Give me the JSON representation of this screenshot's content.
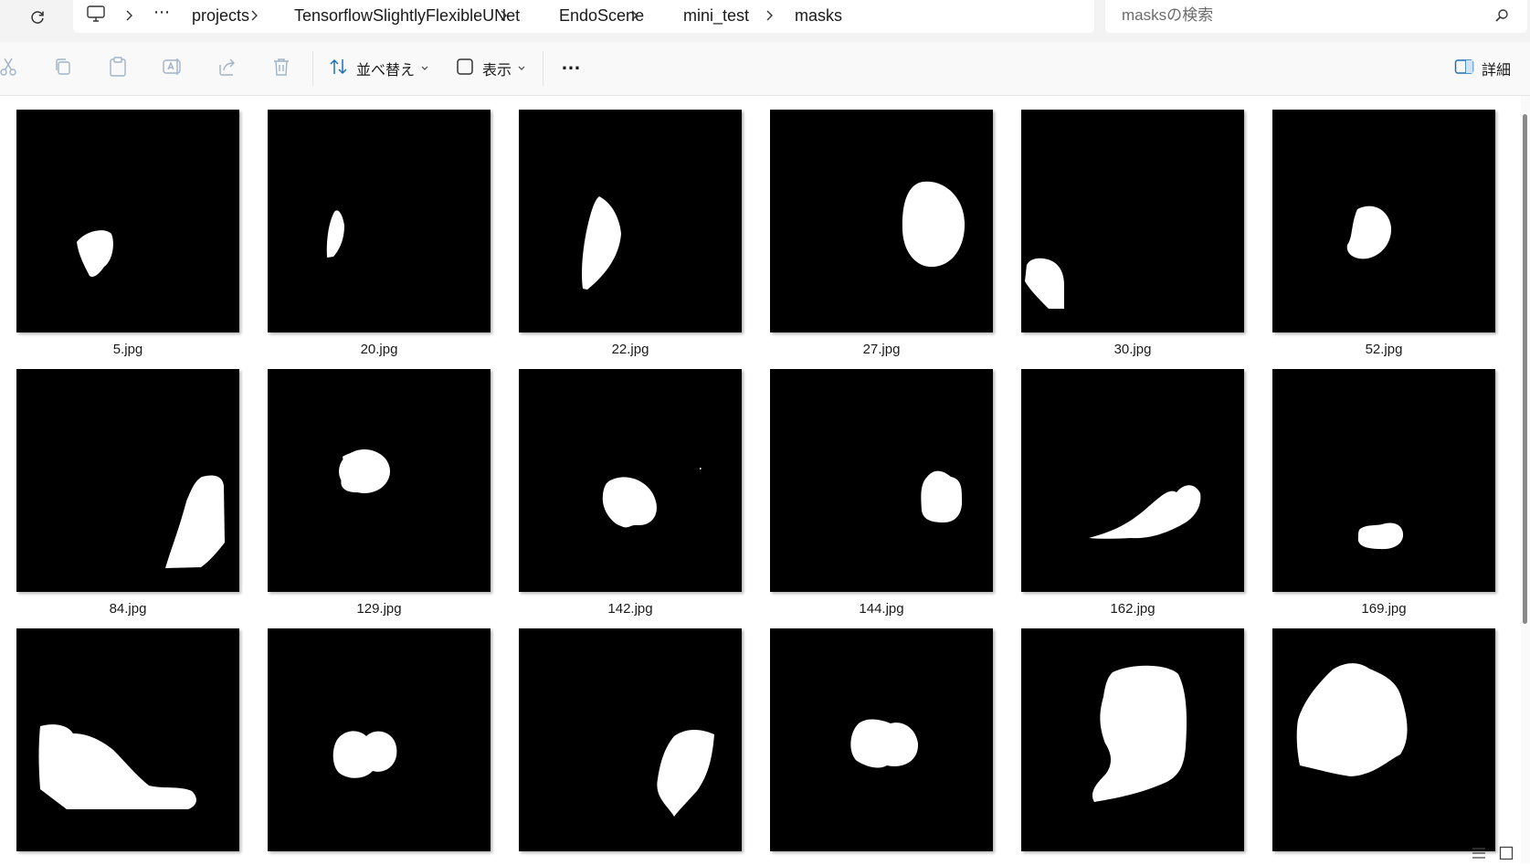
{
  "address": {
    "overflow": "⋯",
    "crumbs": [
      "projects",
      "TensorflowSlightlyFlexibleUNet",
      "EndoScene",
      "mini_test",
      "masks"
    ]
  },
  "search": {
    "placeholder": "masksの検索"
  },
  "toolbar": {
    "sort_label": "並べ替え",
    "view_label": "表示",
    "more_label": "…",
    "details_label": "詳細"
  },
  "files": [
    {
      "name": "5.jpg"
    },
    {
      "name": "20.jpg"
    },
    {
      "name": "22.jpg"
    },
    {
      "name": "27.jpg"
    },
    {
      "name": "30.jpg"
    },
    {
      "name": "52.jpg"
    },
    {
      "name": "84.jpg"
    },
    {
      "name": "129.jpg"
    },
    {
      "name": "142.jpg"
    },
    {
      "name": "144.jpg"
    },
    {
      "name": "162.jpg"
    },
    {
      "name": "169.jpg"
    },
    {
      "name": ""
    },
    {
      "name": ""
    },
    {
      "name": ""
    },
    {
      "name": ""
    },
    {
      "name": ""
    },
    {
      "name": ""
    }
  ]
}
